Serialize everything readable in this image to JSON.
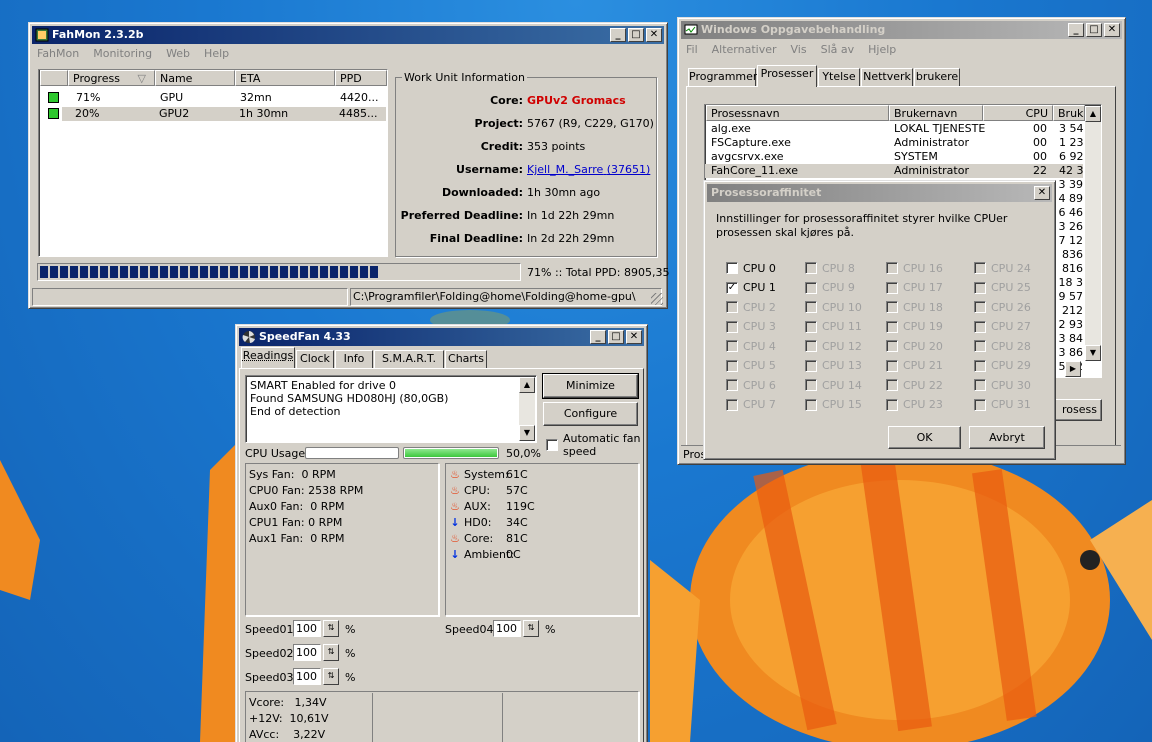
{
  "fahmon": {
    "title": "FahMon 2.3.2b",
    "menu": [
      "FahMon",
      "Monitoring",
      "Web",
      "Help"
    ],
    "cols": [
      "Progress",
      "Name",
      "ETA",
      "PPD"
    ],
    "rows": [
      {
        "progress": "71%",
        "name": "GPU",
        "eta": "32mn",
        "ppd": "4420..."
      },
      {
        "progress": "20%",
        "name": "GPU2",
        "eta": "1h 30mn",
        "ppd": "4485..."
      }
    ],
    "wu_title": "Work Unit Information",
    "labels": [
      "Core:",
      "Project:",
      "Credit:",
      "Username:",
      "Downloaded:",
      "Preferred Deadline:",
      "Final Deadline:"
    ],
    "core": "GPUv2 Gromacs",
    "project": "5767 (R9, C229, G170)",
    "credit": "353 points",
    "username": "Kjell_M._Sarre",
    "userid": "(37651)",
    "downloaded": "1h 30mn ago",
    "preferred": "In 1d 22h 29mn",
    "final": "In 2d 22h 29mn",
    "progress_fraction": 0.71,
    "progress_text": "71% :: Total PPD: 8905,35",
    "status_path": "C:\\Programfiler\\Folding@home\\Folding@home-gpu\\"
  },
  "taskmgr": {
    "title": "Windows Oppgavebehandling",
    "menu": [
      "Fil",
      "Alternativer",
      "Vis",
      "Slå av",
      "Hjelp"
    ],
    "tabs": [
      "Programmer",
      "Prosesser",
      "Ytelse",
      "Nettverk",
      "brukere"
    ],
    "cols": [
      "Prosessnavn",
      "Brukernavn",
      "CPU",
      "Bruk"
    ],
    "rows": [
      {
        "name": "alg.exe",
        "user": "LOKAL TJENESTE",
        "cpu": "00",
        "mem": "3 54"
      },
      {
        "name": "FSCapture.exe",
        "user": "Administrator",
        "cpu": "00",
        "mem": "1 23"
      },
      {
        "name": "avgcsrvx.exe",
        "user": "SYSTEM",
        "cpu": "00",
        "mem": "6 92"
      },
      {
        "name": "FahCore_11.exe",
        "user": "Administrator",
        "cpu": "22",
        "mem": "42 3"
      }
    ],
    "mem_extra": [
      "3 39",
      "4 89",
      "6 46",
      "3 26",
      "7 12",
      "836",
      "816",
      "18 3",
      "9 57",
      "212",
      "2 93",
      "3 84",
      "3 86",
      "50 2"
    ],
    "status_left": "Pros",
    "end_process_label": "rosess"
  },
  "affinity": {
    "title": "Prosessoraffinitet",
    "text": "Innstillinger for prosessoraffinitet styrer hvilke CPUer prosessen skal kjøres på.",
    "cpus": [
      "CPU 0",
      "CPU 1",
      "CPU 2",
      "CPU 3",
      "CPU 4",
      "CPU 5",
      "CPU 6",
      "CPU 7",
      "CPU 8",
      "CPU 9",
      "CPU 10",
      "CPU 11",
      "CPU 12",
      "CPU 13",
      "CPU 14",
      "CPU 15",
      "CPU 16",
      "CPU 17",
      "CPU 18",
      "CPU 19",
      "CPU 20",
      "CPU 21",
      "CPU 22",
      "CPU 23",
      "CPU 24",
      "CPU 25",
      "CPU 26",
      "CPU 27",
      "CPU 28",
      "CPU 29",
      "CPU 30",
      "CPU 31"
    ],
    "checked": [
      1
    ],
    "enabled": [
      0,
      1
    ],
    "ok": "OK",
    "cancel": "Avbryt"
  },
  "speedfan": {
    "title": "SpeedFan 4.33",
    "tabs": [
      "Readings",
      "Clock",
      "Info",
      "S.M.A.R.T.",
      "Charts"
    ],
    "log": [
      "SMART Enabled for drive 0",
      "Found SAMSUNG HD080HJ (80,0GB)",
      "End of detection"
    ],
    "minimize": "Minimize",
    "configure": "Configure",
    "auto_fan": "Automatic fan speed",
    "cpu_usage_label": "CPU Usage",
    "cpu_usage_fraction": 0.0,
    "cpu2_fraction": 1.0,
    "cpu_usage_value": "50,0%",
    "fans": [
      "Sys Fan:  0 RPM",
      "CPU0 Fan: 2538 RPM",
      "Aux0 Fan:  0 RPM",
      "CPU1 Fan: 0 RPM",
      "Aux1 Fan:  0 RPM"
    ],
    "temps": [
      {
        "label": "System:",
        "value": "61C",
        "icon": "flame-icon"
      },
      {
        "label": "CPU:",
        "value": "57C",
        "icon": "flame-icon"
      },
      {
        "label": "AUX:",
        "value": "119C",
        "icon": "flame-icon"
      },
      {
        "label": "HD0:",
        "value": "34C",
        "icon": "down-arrow-icon"
      },
      {
        "label": "Core:",
        "value": "81C",
        "icon": "flame-icon"
      },
      {
        "label": "Ambient:",
        "value": "0C",
        "icon": "down-arrow-icon"
      }
    ],
    "speeds": [
      {
        "label": "Speed01:",
        "value": "100"
      },
      {
        "label": "Speed02:",
        "value": "100"
      },
      {
        "label": "Speed03:",
        "value": "100"
      },
      {
        "label": "Speed04:",
        "value": "100"
      }
    ],
    "pct": "%",
    "volts": [
      "Vcore:   1,34V",
      "+12V:  10,61V",
      "AVcc:    3,22V"
    ]
  },
  "colors": {
    "titlebar": "#0a246a",
    "core_text": "#d00000",
    "link": "#0000cc",
    "progress": "#0a246a",
    "cpu_bar": "#4cd64c"
  }
}
